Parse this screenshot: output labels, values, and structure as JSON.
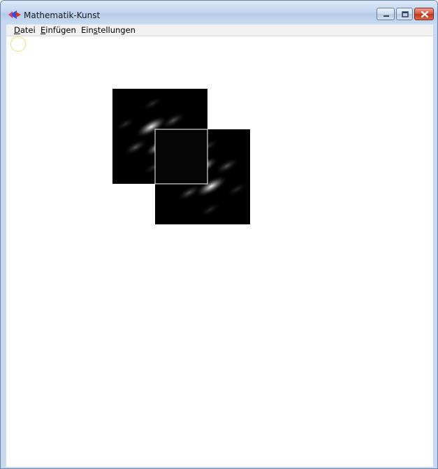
{
  "window": {
    "title": "Mathematik-Kunst",
    "app_icon": "app-icon",
    "controls": {
      "minimize_icon": "minimize-icon",
      "maximize_icon": "maximize-icon",
      "close_icon": "close-icon"
    }
  },
  "menu": {
    "items": [
      {
        "label": "Datei",
        "mnemonic": "D"
      },
      {
        "label": "Einfügen",
        "mnemonic": "E"
      },
      {
        "label": "Einstellungen",
        "mnemonic": "s"
      }
    ]
  },
  "canvas": {
    "background": "#ffffff",
    "tiles": [
      {
        "name": "pattern-tile-back",
        "fill": "#000000"
      },
      {
        "name": "pattern-tile-front",
        "fill": "#000000"
      }
    ],
    "selection_outline_color": "#ffffff",
    "cursor_indicator_color": "#e8e070"
  }
}
